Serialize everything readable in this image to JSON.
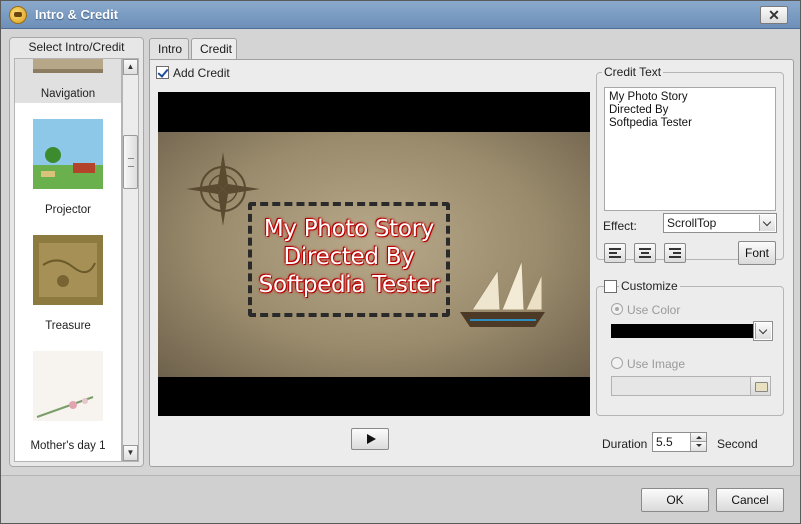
{
  "window": {
    "title": "Intro & Credit"
  },
  "left_panel": {
    "header": "Select Intro/Credit",
    "items": [
      {
        "label": "Navigation"
      },
      {
        "label": "Projector"
      },
      {
        "label": "Treasure"
      },
      {
        "label": "Mother's day 1"
      }
    ]
  },
  "tabs": [
    {
      "label": "Intro"
    },
    {
      "label": "Credit"
    }
  ],
  "credit": {
    "add_credit_label": "Add Credit",
    "preview_lines": [
      "My Photo Story",
      "Directed By",
      "Softpedia Tester"
    ],
    "credit_text_group": "Credit Text",
    "credit_text": "My Photo Story\nDirected By\nSoftpedia Tester",
    "effect_label": "Effect:",
    "effect_value": "ScrollTop",
    "font_button": "Font",
    "customize_label": "Customize",
    "use_color_label": "Use Color",
    "use_image_label": "Use Image",
    "duration_label": "Duration",
    "duration_value": "5.5",
    "duration_unit": "Second",
    "customize_color": "#000000"
  },
  "footer": {
    "ok_label": "OK",
    "cancel_label": "Cancel"
  }
}
